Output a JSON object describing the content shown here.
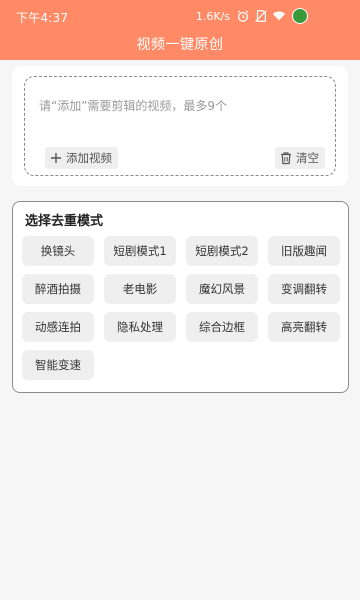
{
  "status_bar": {
    "time": "下午4:37",
    "net_speed": "1.6K/s",
    "icons": [
      "alarm-icon",
      "no-sim-icon",
      "wifi-icon",
      "app-avatar-icon"
    ]
  },
  "header": {
    "title": "视频一键原创",
    "background_color": "#ff8a65"
  },
  "upload": {
    "hint": "请“添加”需要剪辑的视频，最多9个",
    "add_button_label": "添加视频",
    "add_button_icon": "plus-icon",
    "clear_button_label": "清空",
    "clear_button_icon": "trash-icon"
  },
  "modes": {
    "title": "选择去重模式",
    "items": [
      {
        "label": "换镜头"
      },
      {
        "label": "短剧模式1"
      },
      {
        "label": "短剧模式2"
      },
      {
        "label": "旧版趣闻"
      },
      {
        "label": "醉酒拍摄"
      },
      {
        "label": "老电影"
      },
      {
        "label": "魔幻风景"
      },
      {
        "label": "变调翻转"
      },
      {
        "label": "动感连拍"
      },
      {
        "label": "隐私处理"
      },
      {
        "label": "综合边框"
      },
      {
        "label": "高亮翻转"
      },
      {
        "label": "智能变速"
      }
    ]
  }
}
